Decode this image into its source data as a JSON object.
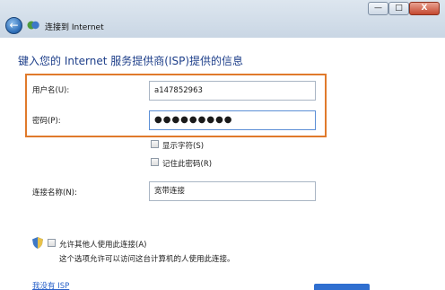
{
  "window": {
    "title": "连接到 Internet",
    "controls": {
      "minimize": "—",
      "maximize": "□",
      "close": "X"
    }
  },
  "form": {
    "heading": "键入您的 Internet 服务提供商(ISP)提供的信息",
    "username": {
      "label": "用户名(U):",
      "value": "a147852963"
    },
    "password": {
      "label": "密码(P):",
      "value": "●●●●●●●●●"
    },
    "show_chars": {
      "label": "显示字符(S)",
      "checked": false
    },
    "remember_password": {
      "label": "记住此密码(R)",
      "checked": false
    },
    "connection_name": {
      "label": "连接名称(N):",
      "value": "宽带连接"
    },
    "allow_others": {
      "label": "允许其他人使用此连接(A)",
      "description": "这个选项允许可以访问这台计算机的人使用此连接。",
      "checked": false
    },
    "no_isp_link": "我没有 ISP"
  },
  "colors": {
    "highlight_border": "#e07a2b",
    "heading": "#1e3f8a",
    "link": "#2a62c9"
  },
  "icons": [
    "back-arrow-icon",
    "network-connection-icon",
    "shield-icon"
  ]
}
